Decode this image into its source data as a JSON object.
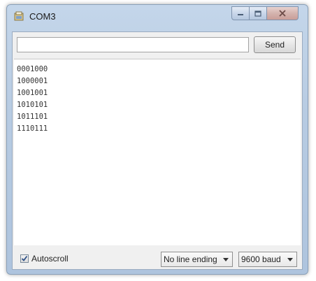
{
  "window": {
    "title": "COM3",
    "controls": {
      "minimize_icon": "minimize-icon",
      "maximize_icon": "maximize-icon",
      "close_icon": "close-icon"
    }
  },
  "toolbar": {
    "input_value": "",
    "send_label": "Send"
  },
  "output": {
    "lines": [
      "0001000",
      "1000001",
      "1001001",
      "1010101",
      "1011101",
      "1110111"
    ]
  },
  "footer": {
    "autoscroll_label": "Autoscroll",
    "autoscroll_checked": true,
    "line_ending": "No line ending",
    "baud_rate": "9600 baud"
  }
}
